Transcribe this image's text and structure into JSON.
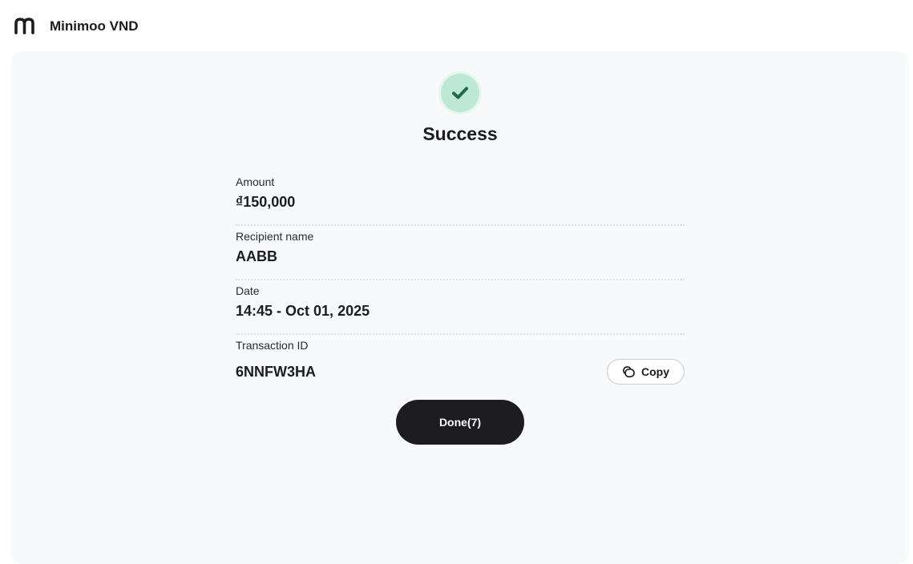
{
  "header": {
    "logo_icon": "minimoo-logo-icon",
    "title": "Minimoo VND"
  },
  "status": {
    "icon": "check-icon",
    "title": "Success",
    "colors": {
      "icon_bg": "#bde8d6",
      "icon_ring": "#e6f5ee",
      "check": "#1f6b45"
    }
  },
  "details": [
    {
      "label": "Amount",
      "value": "₫150,000"
    },
    {
      "label": "Recipient name",
      "value": "AABB"
    },
    {
      "label": "Date",
      "value": "14:45 - Oct 01, 2025"
    },
    {
      "label": "Transaction ID",
      "value": "6NNFW3HA"
    }
  ],
  "copy": {
    "icon": "copy-icon",
    "label": "Copy"
  },
  "done_button": {
    "label": "Done(7)"
  }
}
